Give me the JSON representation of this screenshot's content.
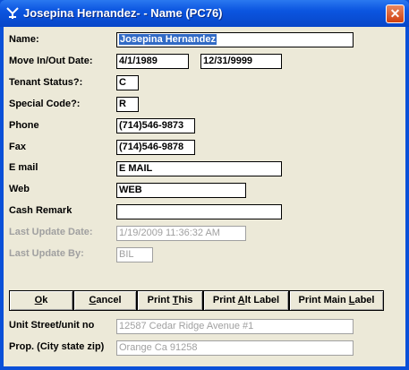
{
  "window": {
    "title": "Josepina Hernandez- - Name (PC76)",
    "app_icon": "app-icon",
    "close_glyph": "✕"
  },
  "fields": {
    "name": {
      "label": "Name:",
      "value": "Josepina Hernandez"
    },
    "move_in_out": {
      "label": "Move In/Out Date:",
      "move_in": "4/1/1989",
      "move_out": "12/31/9999"
    },
    "tenant_status": {
      "label": "Tenant Status?:",
      "value": "C"
    },
    "special_code": {
      "label": "Special Code?:",
      "value": "R"
    },
    "phone": {
      "label": "Phone",
      "value": "(714)546-9873"
    },
    "fax": {
      "label": "Fax",
      "value": "(714)546-9878"
    },
    "email": {
      "label": "E mail",
      "value": "E MAIL"
    },
    "web": {
      "label": "Web",
      "value": "WEB"
    },
    "cash_remark": {
      "label": "Cash Remark",
      "value": ""
    },
    "last_update_date": {
      "label": "Last Update Date:",
      "value": "1/19/2009 11:36:32 AM"
    },
    "last_update_by": {
      "label": "Last Update By:",
      "value": "BIL"
    },
    "unit_street": {
      "label": "Unit Street/unit no",
      "value": "12587 Cedar Ridge Avenue #1"
    },
    "prop_city": {
      "label": "Prop. (City state zip)",
      "value": "Orange Ca 91258"
    }
  },
  "buttons": {
    "ok": {
      "accel": "O",
      "rest": "k"
    },
    "cancel": {
      "accel": "C",
      "rest": "ancel"
    },
    "print_this": {
      "pre": "Print ",
      "accel": "T",
      "rest": "his"
    },
    "print_alt": {
      "pre": "Print ",
      "accel": "A",
      "rest": "lt Label"
    },
    "print_main": {
      "pre": "Print Main ",
      "accel": "L",
      "rest": "abel"
    }
  }
}
